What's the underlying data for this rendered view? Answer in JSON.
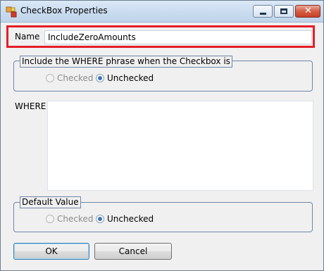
{
  "window": {
    "title": "CheckBox Properties"
  },
  "name_field": {
    "label": "Name",
    "value": "IncludeZeroAmounts"
  },
  "where_group": {
    "legend": "Include the WHERE phrase when the Checkbox is",
    "options": [
      {
        "label": "Checked",
        "selected": false
      },
      {
        "label": "Unchecked",
        "selected": true
      }
    ]
  },
  "where_field": {
    "label": "WHERE",
    "value": ""
  },
  "default_group": {
    "legend": "Default Value",
    "options": [
      {
        "label": "Checked",
        "selected": false
      },
      {
        "label": "Unchecked",
        "selected": true
      }
    ]
  },
  "buttons": {
    "ok": "OK",
    "cancel": "Cancel"
  },
  "colors": {
    "highlight": "#e41e26",
    "titlebar": "#c9dcef",
    "close": "#c74126"
  }
}
